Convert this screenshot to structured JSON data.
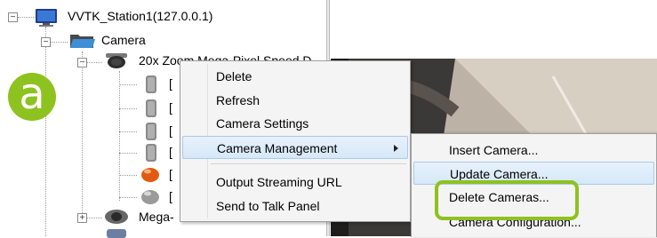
{
  "tree": {
    "station_label": "VVTK_Station1(127.0.0.1)",
    "camera_folder_label": "Camera",
    "camera_item_label": "20x Zoom Mega-Pixel Speed D",
    "sub_prefix": "[",
    "mega_label": "Mega-"
  },
  "badge": {
    "label": "a"
  },
  "context_menu": {
    "items": [
      "Delete",
      "Refresh",
      "Camera Settings",
      "Camera Management",
      "Output Streaming URL",
      "Send to Talk Panel"
    ]
  },
  "submenu": {
    "items": [
      "Insert Camera...",
      "Update Camera...",
      "Delete Cameras...",
      "Camera Configuration..."
    ]
  },
  "colors": {
    "badge": "#8ec21f",
    "highlight": "#d6e8f8"
  }
}
